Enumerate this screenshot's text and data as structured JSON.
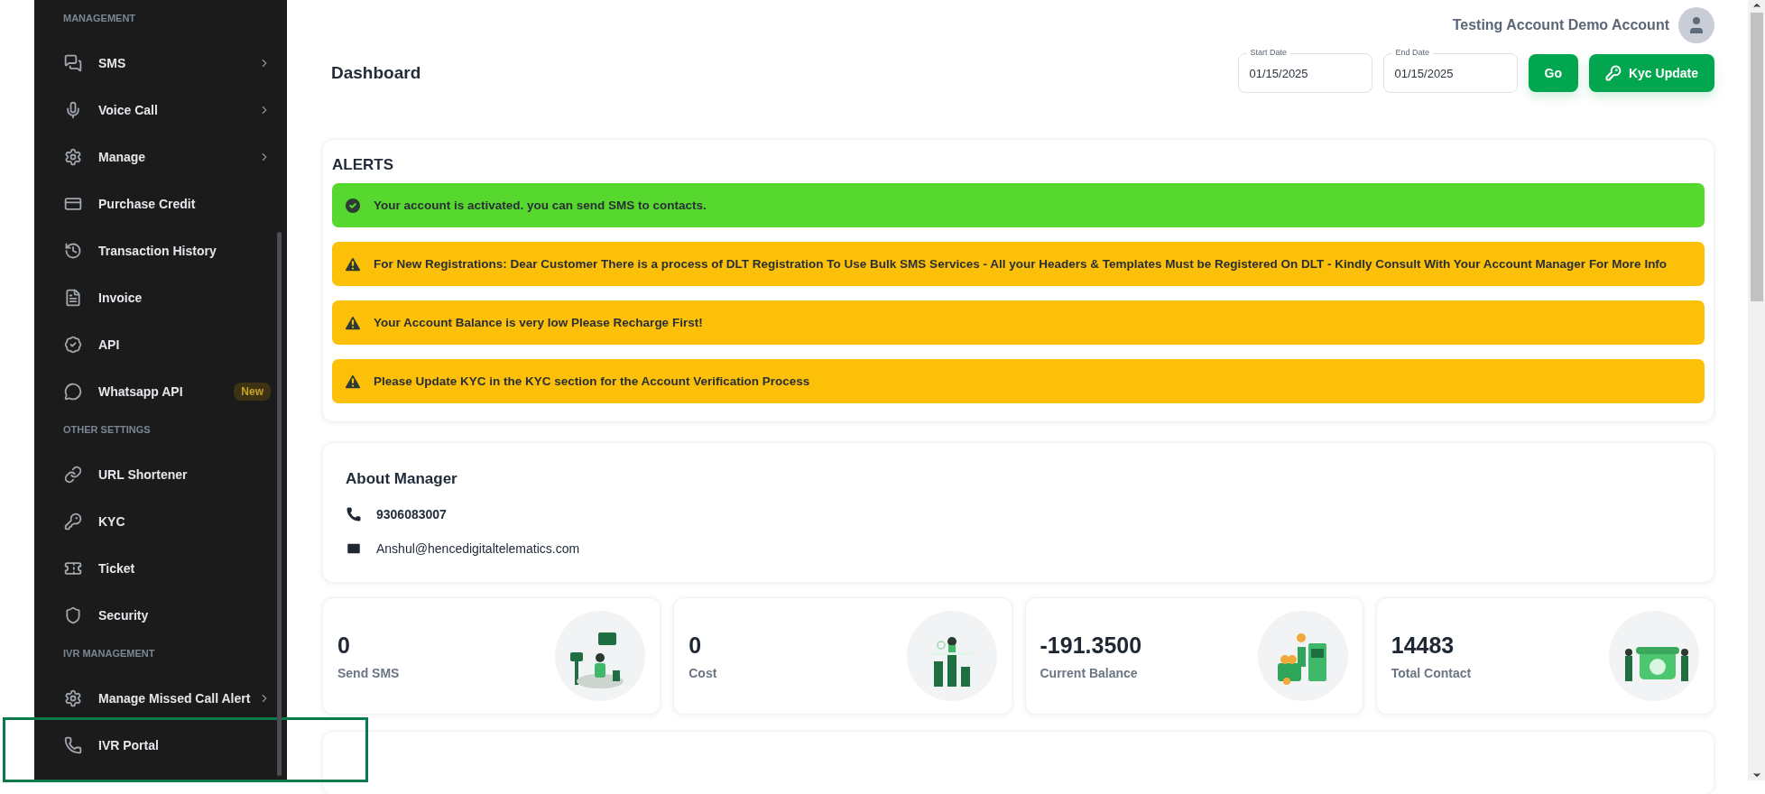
{
  "sidebar": {
    "sections": [
      {
        "title": "MANAGEMENT",
        "items": [
          {
            "label": "SMS",
            "has_submenu": true,
            "highlighted": false
          },
          {
            "label": "Voice Call",
            "has_submenu": true,
            "highlighted": false
          },
          {
            "label": "Manage",
            "has_submenu": true,
            "highlighted": false
          },
          {
            "label": "Purchase Credit",
            "has_submenu": false,
            "highlighted": false
          },
          {
            "label": "Transaction History",
            "has_submenu": false,
            "highlighted": false
          },
          {
            "label": "Invoice",
            "has_submenu": false,
            "highlighted": false
          },
          {
            "label": "API",
            "has_submenu": false,
            "highlighted": false
          },
          {
            "label": "Whatsapp API",
            "has_submenu": false,
            "badge": "New",
            "highlighted": false
          }
        ]
      },
      {
        "title": "OTHER SETTINGS",
        "items": [
          {
            "label": "URL Shortener",
            "has_submenu": false,
            "highlighted": false
          },
          {
            "label": "KYC",
            "has_submenu": false,
            "highlighted": false
          },
          {
            "label": "Ticket",
            "has_submenu": false,
            "highlighted": false
          },
          {
            "label": "Security",
            "has_submenu": false,
            "highlighted": false
          }
        ]
      },
      {
        "title": "IVR MANAGEMENT",
        "items": [
          {
            "label": "Manage Missed Call Alert",
            "has_submenu": true,
            "highlighted": false
          },
          {
            "label": "IVR Portal",
            "has_submenu": false,
            "highlighted": true
          }
        ]
      }
    ]
  },
  "header": {
    "user_name": "Testing Account Demo Account"
  },
  "page_title": "Dashboard",
  "filters": {
    "start_date": {
      "label": "Start Date",
      "value": "01/15/2025"
    },
    "end_date": {
      "label": "End Date",
      "value": "01/15/2025"
    },
    "buttons": [
      "Go",
      "Kyc Update"
    ]
  },
  "alerts": {
    "title": "ALERTS",
    "items": [
      {
        "kind": "success",
        "text": "Your account is activated. you can send SMS to contacts."
      },
      {
        "kind": "warning",
        "text": "For New Registrations: Dear Customer There is a process of DLT Registration To Use Bulk SMS Services - All your Headers & Templates Must be Registered On DLT - Kindly Consult With Your Account Manager For More Info"
      },
      {
        "kind": "warning",
        "text": "Your Account Balance is very low Please Recharge First!"
      },
      {
        "kind": "warning",
        "text": "Please Update KYC in the KYC section for the Account Verification Process"
      }
    ]
  },
  "about_manager": {
    "title": "About Manager",
    "phone": "9306083007",
    "email": "Anshul@hencedigitaltelematics.com"
  },
  "stats": [
    {
      "value": "0",
      "label": "Send SMS"
    },
    {
      "value": "0",
      "label": "Cost"
    },
    {
      "value": "-191.3500",
      "label": "Current Balance"
    },
    {
      "value": "14483",
      "label": "Total Contact"
    }
  ]
}
